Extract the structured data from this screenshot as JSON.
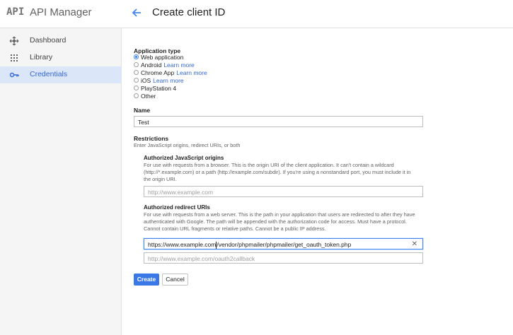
{
  "header": {
    "logo_text": "API",
    "app_title": "API Manager",
    "page_title": "Create client ID",
    "back_icon": "arrow-left-icon"
  },
  "sidebar": {
    "items": [
      {
        "label": "Dashboard",
        "icon": "dashboard-icon",
        "active": false
      },
      {
        "label": "Library",
        "icon": "library-icon",
        "active": false
      },
      {
        "label": "Credentials",
        "icon": "key-icon",
        "active": true
      }
    ]
  },
  "form": {
    "application_type_label": "Application type",
    "application_types": [
      {
        "label": "Web application",
        "selected": true,
        "learn_more": ""
      },
      {
        "label": "Android",
        "selected": false,
        "learn_more": "Learn more"
      },
      {
        "label": "Chrome App",
        "selected": false,
        "learn_more": "Learn more"
      },
      {
        "label": "iOS",
        "selected": false,
        "learn_more": "Learn more"
      },
      {
        "label": "PlayStation 4",
        "selected": false,
        "learn_more": ""
      },
      {
        "label": "Other",
        "selected": false,
        "learn_more": ""
      }
    ],
    "name_label": "Name",
    "name_value": "Test",
    "restrictions_label": "Restrictions",
    "restrictions_desc": "Enter JavaScript origins, redirect URIs, or both",
    "js_origins": {
      "title": "Authorized JavaScript origins",
      "desc_line1": "For use with requests from a browser. This is the origin URI of the client application. It can't contain a wildcard",
      "desc_line2": "(http://*.example.com) or a path (http://example.com/subdir). If you're using a nonstandard port, you must include it in",
      "desc_line3": "the origin URI.",
      "placeholder": "http://www.example.com"
    },
    "redirect_uris": {
      "title": "Authorized redirect URIs",
      "desc_line1": "For use with requests from a web server. This is the path in your application that users are redirected to after they have",
      "desc_line2": "authenticated with Google. The path will be appended with the authorization code for access. Must have a protocol.",
      "desc_line3": "Cannot contain URL fragments or relative paths. Cannot be a public IP address.",
      "value_before_caret": "https://www.example.com",
      "value_after_caret": "/vendor/phpmailer/phpmailer/get_oauth_token.php",
      "placeholder": "http://www.example.com/oauth2callback"
    },
    "create_label": "Create",
    "cancel_label": "Cancel"
  },
  "colors": {
    "accent": "#3b78e7",
    "sidebar_bg": "#f5f5f5",
    "active_bg": "#dbe6f8"
  }
}
